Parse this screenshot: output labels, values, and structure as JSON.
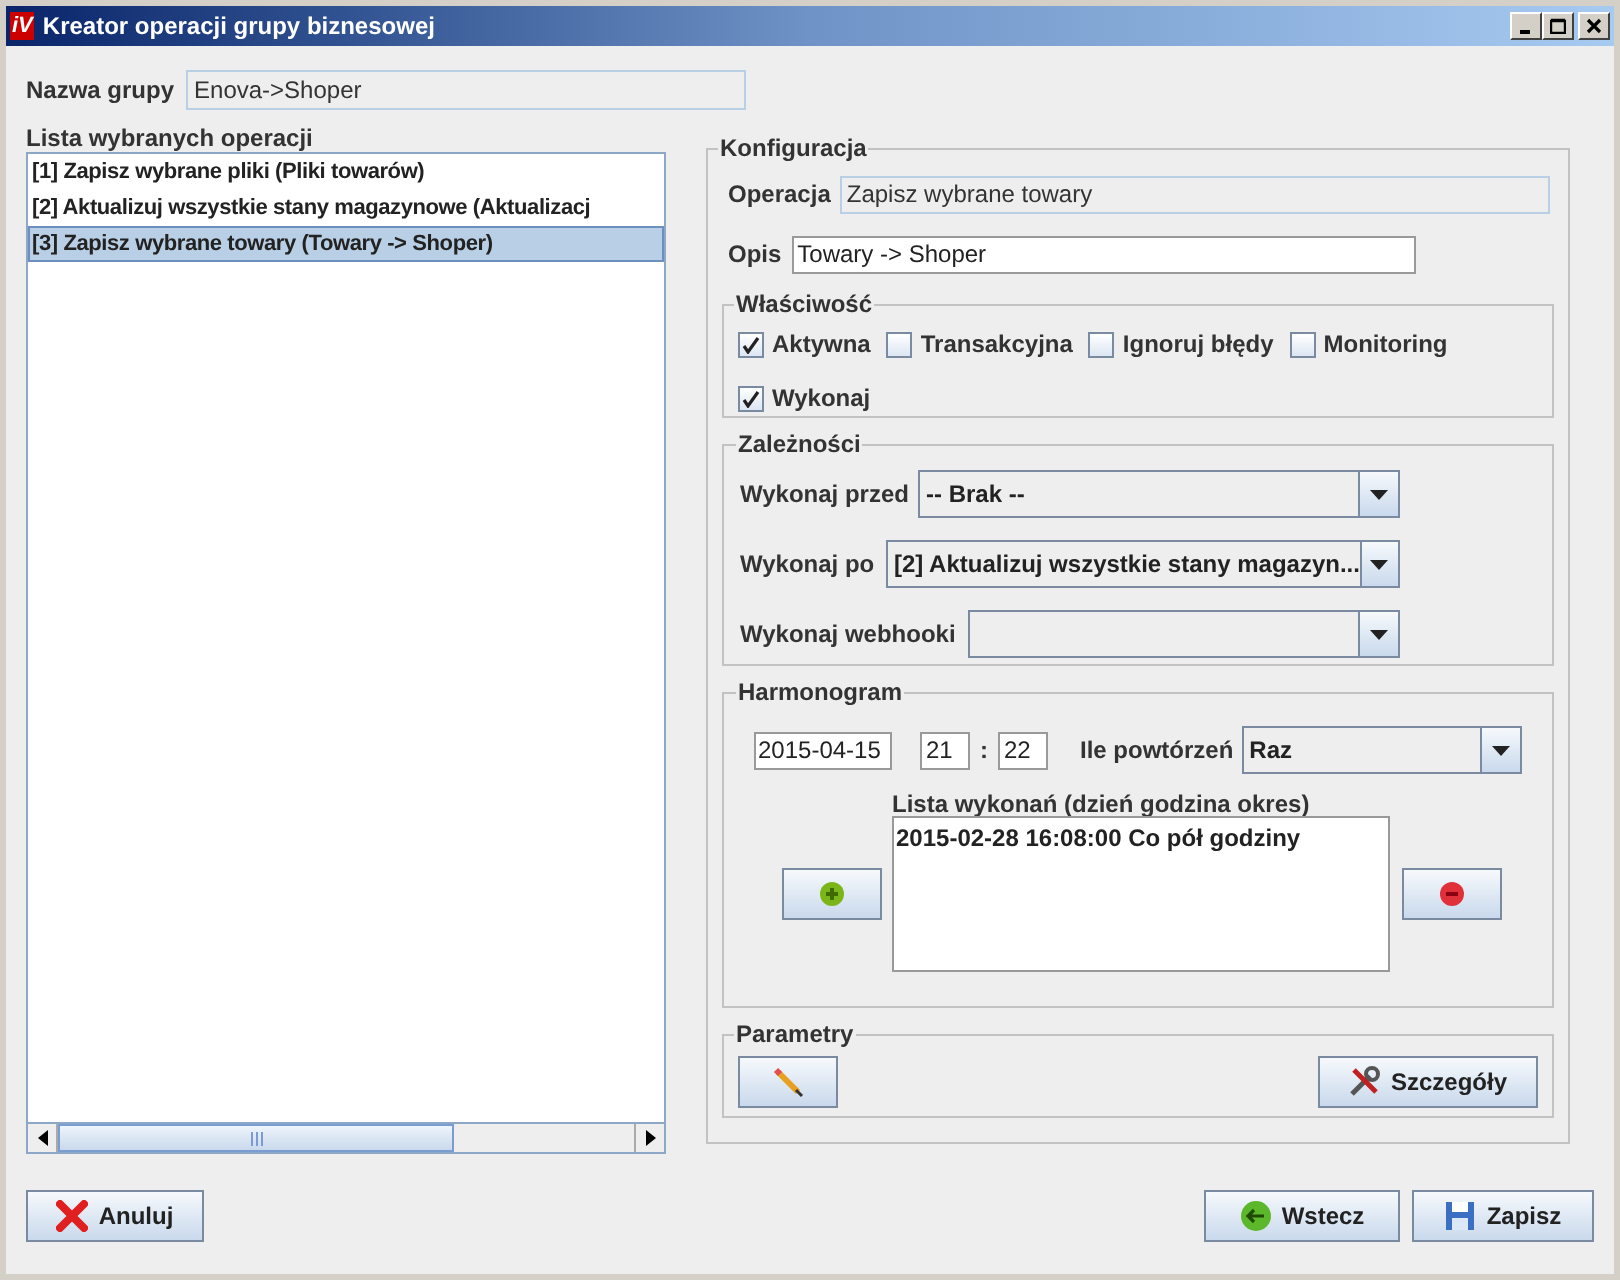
{
  "window": {
    "app_icon": "iV",
    "title": "Kreator operacji grupy biznesowej"
  },
  "group_name": {
    "label": "Nazwa grupy",
    "value": "Enova->Shoper"
  },
  "operations": {
    "label": "Lista wybranych operacji",
    "items": [
      {
        "text": "[1] Zapisz wybrane pliki (Pliki towarów)",
        "selected": false
      },
      {
        "text": "[2] Aktualizuj wszystkie stany magazynowe (Aktualizacj",
        "selected": false
      },
      {
        "text": "[3] Zapisz wybrane towary (Towary -> Shoper)",
        "selected": true
      }
    ]
  },
  "configuration": {
    "title": "Konfiguracja",
    "operation": {
      "label": "Operacja",
      "value": "Zapisz wybrane towary"
    },
    "description": {
      "label": "Opis",
      "value": "Towary -> Shoper"
    },
    "properties": {
      "title": "Właściwość",
      "checkboxes": [
        {
          "label": "Aktywna",
          "checked": true
        },
        {
          "label": "Transakcyjna",
          "checked": false
        },
        {
          "label": "Ignoruj błędy",
          "checked": false
        },
        {
          "label": "Monitoring",
          "checked": false
        },
        {
          "label": "Wykonaj",
          "checked": true
        }
      ]
    },
    "dependencies": {
      "title": "Zależności",
      "rows": [
        {
          "label": "Wykonaj przed",
          "value": "-- Brak --"
        },
        {
          "label": "Wykonaj po",
          "value": "[2] Aktualizuj wszystkie stany magazyn..."
        },
        {
          "label": "Wykonaj webhooki",
          "value": ""
        }
      ]
    },
    "schedule": {
      "title": "Harmonogram",
      "date": "2015-04-15",
      "hour": "21",
      "separator": ":",
      "minute": "22",
      "repeat_label": "Ile powtórzeń",
      "repeat_value": "Raz",
      "list_label": "Lista wykonań (dzień godzina okres)",
      "list_items": [
        "2015-02-28 16:08:00 Co pół godziny"
      ]
    },
    "parameters": {
      "title": "Parametry",
      "details_button": "Szczegóły"
    }
  },
  "buttons": {
    "cancel": "Anuluj",
    "back": "Wstecz",
    "save": "Zapisz"
  }
}
